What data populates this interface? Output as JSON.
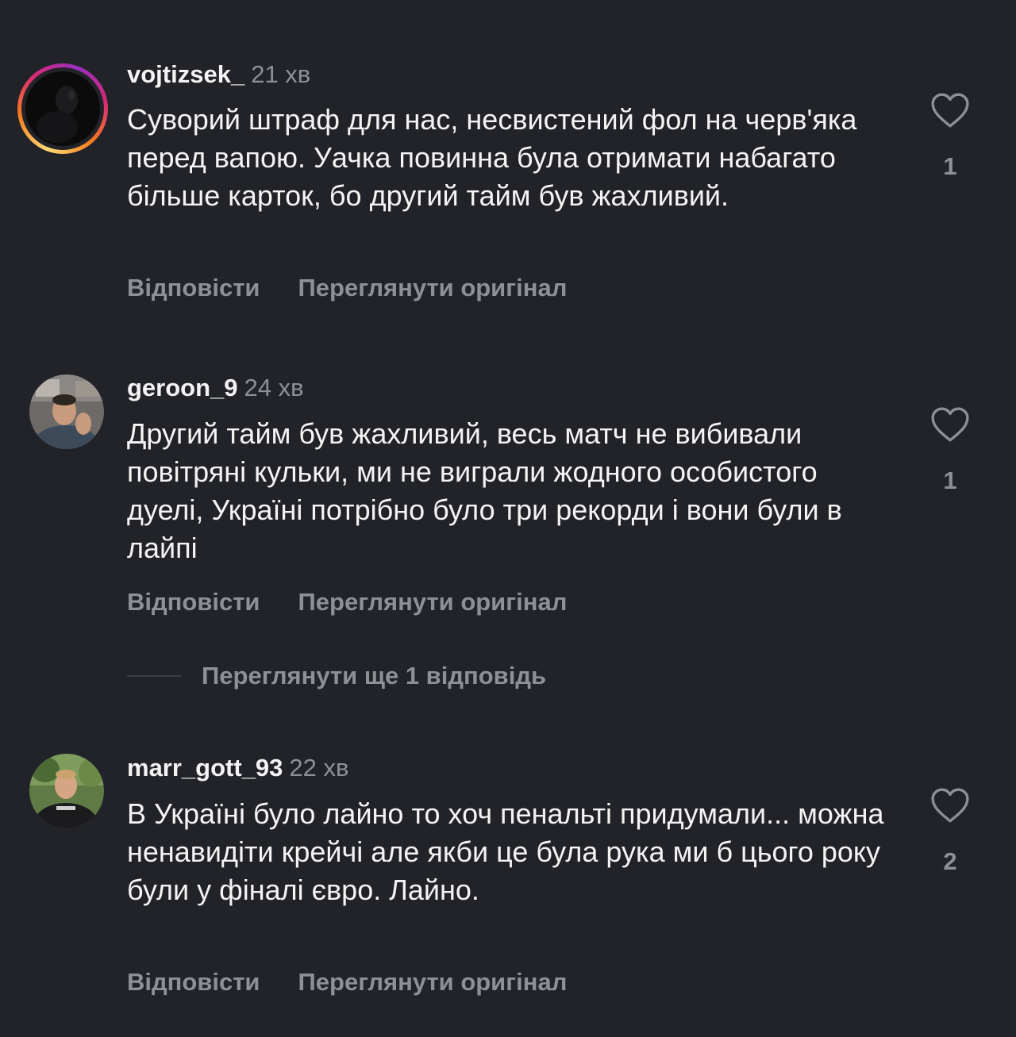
{
  "comments": [
    {
      "username": "vojtizsek_",
      "time": "21 хв",
      "text": "Суворий штраф для нас, несвистений фол на черв'яка перед вапою. Уачка повинна була отримати набагато більше карток, бо другий тайм був жахливий.",
      "reply_label": "Відповісти",
      "translate_label": "Переглянути оригінал",
      "likes": "1",
      "has_story_ring": true
    },
    {
      "username": "geroon_9",
      "time": "24 хв",
      "text": "Другий тайм був жахливий, весь матч не вибивали повітряні кульки, ми не виграли жодного особистого дуелі, Україні потрібно було три рекорди і вони були в лайпі",
      "reply_label": "Відповісти",
      "translate_label": "Переглянути оригінал",
      "likes": "1",
      "has_story_ring": false
    },
    {
      "username": "marr_gott_93",
      "time": "22 хв",
      "text": "В Україні було лайно то хоч пенальті придумали... можна ненавидіти крейчі але якби це була рука ми б цього року були у фіналі євро. Лайно.",
      "reply_label": "Відповісти",
      "translate_label": "Переглянути оригінал",
      "likes": "2",
      "has_story_ring": false
    }
  ],
  "view_replies_label": "Переглянути ще 1 відповідь",
  "colors": {
    "background": "#212328",
    "primary_text": "#f4f4f4",
    "secondary_text": "#8e9096"
  },
  "icons": {
    "like": "heart-outline-icon"
  }
}
